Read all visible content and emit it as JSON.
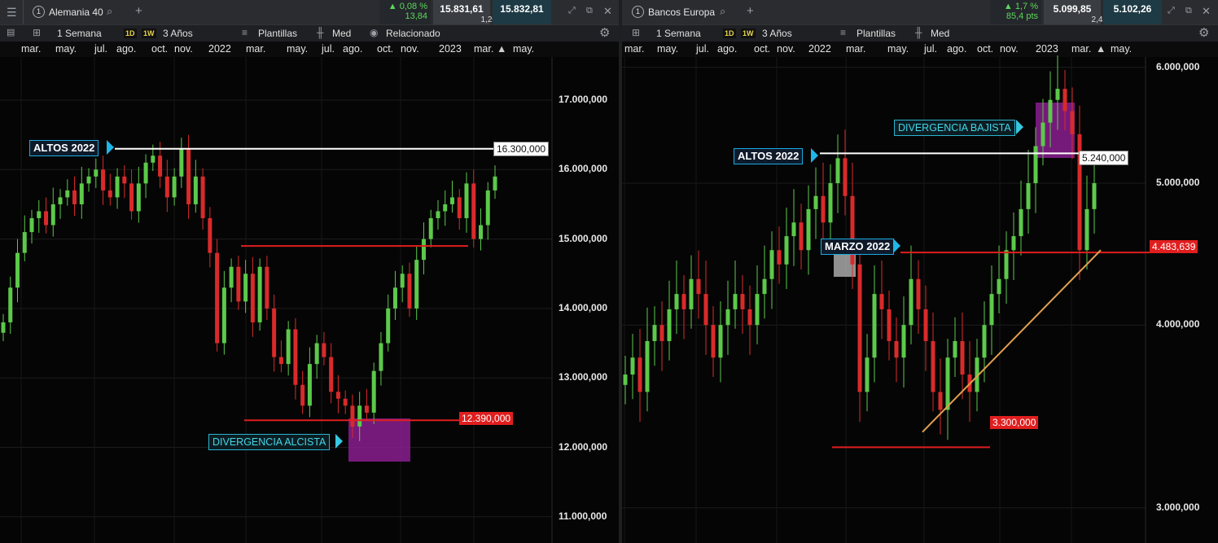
{
  "colors": {
    "up": "#5cc94a",
    "down": "#d92a2a",
    "hline_white": "#ffffff",
    "hline_red": "#e01e1e",
    "trend": "#e0a050",
    "divergence_box": "#8a1f8f",
    "bg": "#050505"
  },
  "left": {
    "instrument": "Alemania 40",
    "slot_number": "1",
    "change": "0,08 %",
    "change_points": "13,84",
    "bid": "15.831,61",
    "ask": "15.832,81",
    "spread": "1,20",
    "menu_icon": "hamburger-icon",
    "controls": {
      "interval": "1 Semana",
      "d1": "1D",
      "w1": "1W",
      "range": "3 Años",
      "templates": "Plantillas",
      "price_type": "Med",
      "related": "Relacionado"
    },
    "months": [
      "mar.",
      "may.",
      "jul.",
      "ago.",
      "oct.",
      "nov.",
      "2022",
      "mar.",
      "may.",
      "jul.",
      "ago.",
      "oct.",
      "nov.",
      "2023",
      "mar.",
      "may."
    ],
    "y_axis": [
      "17.000,000",
      "16.000,000",
      "15.000,000",
      "14.000,000",
      "13.000,000",
      "12.000,000",
      "11.000,000"
    ],
    "price_tag_high": "16.300,000",
    "price_tag_low": "12.390,000",
    "callout_highs": "ALTOS 2022",
    "callout_divergence": "DIVERGENCIA  ALCISTA"
  },
  "right": {
    "instrument": "Bancos Europa",
    "slot_number": "1",
    "change": "1,7 %",
    "change_points": "85,4 pts",
    "bid": "5.099,85",
    "ask": "5.102,26",
    "spread": "2,41",
    "controls": {
      "interval": "1 Semana",
      "d1": "1D",
      "w1": "1W",
      "range": "3 Años",
      "templates": "Plantillas",
      "price_type": "Med"
    },
    "months": [
      "mar.",
      "may.",
      "jul.",
      "ago.",
      "oct.",
      "nov.",
      "2022",
      "mar.",
      "may.",
      "jul.",
      "ago.",
      "oct.",
      "nov.",
      "2023",
      "mar.",
      "may."
    ],
    "y_axis": [
      "6.000,000",
      "5.000,000",
      "4.000,000",
      "3.000,000"
    ],
    "price_tag_high": "5.240,000",
    "price_tag_current": "4.483,639",
    "price_tag_low": "3.300,000",
    "callout_highs": "ALTOS 2022",
    "callout_march": "MARZO 2022",
    "callout_divergence": "DIVERGENCIA BAJISTA"
  },
  "chart_data": [
    {
      "type": "candlestick",
      "title": "Alemania 40",
      "period": "1 Semana",
      "ylim": [
        11000,
        17500
      ],
      "y_ticks": [
        17000,
        16000,
        15000,
        14000,
        13000,
        12000,
        11000
      ],
      "horizontal_levels": [
        16300,
        14900,
        12390
      ],
      "close_series": [
        13800,
        14300,
        14800,
        15100,
        15300,
        15400,
        15200,
        15500,
        15600,
        15700,
        15500,
        15800,
        15900,
        16000,
        15700,
        15600,
        15900,
        15800,
        15400,
        15800,
        16100,
        16200,
        15900,
        15600,
        15900,
        16300,
        15500,
        15900,
        15300,
        14800,
        13500,
        14300,
        14600,
        14100,
        14500,
        13800,
        14600,
        14000,
        13300,
        13200,
        13700,
        12900,
        12600,
        13200,
        13500,
        13300,
        12800,
        12700,
        12600,
        12300,
        12600,
        12500,
        13100,
        13500,
        14000,
        14300,
        14500,
        14000,
        14700,
        15000,
        15300,
        15400,
        15500,
        15600,
        15300,
        15800,
        15000,
        15200,
        15700,
        15900
      ]
    },
    {
      "type": "candlestick",
      "title": "Bancos Europa",
      "period": "1 Semana",
      "scale": "log",
      "ylim": [
        2700,
        6300
      ],
      "y_ticks": [
        6000,
        5000,
        4000,
        3000
      ],
      "horizontal_levels": [
        5240,
        4483.639,
        3300
      ],
      "trendline": {
        "from": 3380,
        "to": 4500
      },
      "close_series": [
        3700,
        3800,
        3600,
        3900,
        4000,
        3900,
        4100,
        4200,
        4100,
        4300,
        4200,
        4000,
        3800,
        4000,
        4100,
        4200,
        4100,
        4000,
        4200,
        4300,
        4500,
        4400,
        4600,
        4700,
        4500,
        4800,
        4900,
        4700,
        5000,
        5200,
        4900,
        4400,
        3600,
        3800,
        4200,
        4100,
        3900,
        3800,
        4000,
        4300,
        4100,
        3900,
        3600,
        3500,
        3800,
        3900,
        3700,
        3600,
        3800,
        4000,
        4200,
        4300,
        4500,
        4600,
        4800,
        5000,
        5300,
        5500,
        5700,
        5800,
        5600,
        5400,
        4500,
        4800,
        5000
      ]
    }
  ]
}
